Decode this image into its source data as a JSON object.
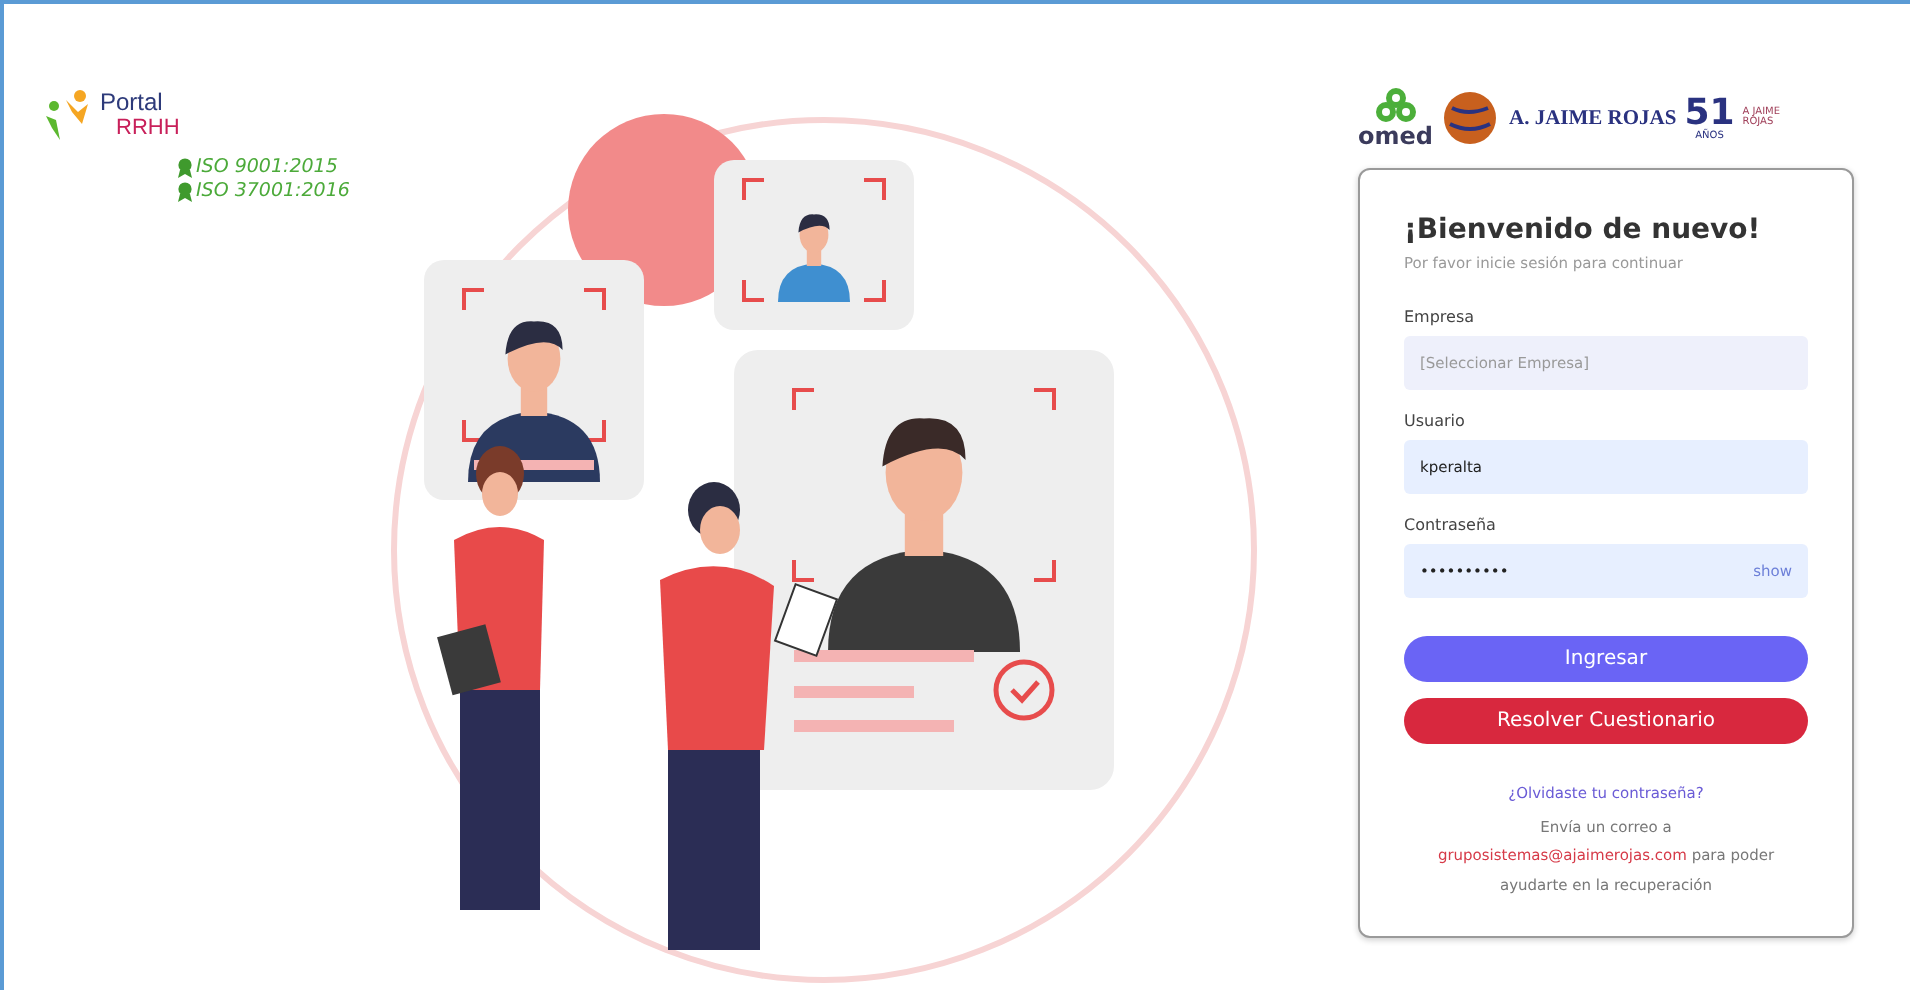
{
  "brand": {
    "name": "Portal",
    "product": "RRHH",
    "certifications": [
      "ISO 9001:2015",
      "ISO 37001:2016"
    ]
  },
  "partner_logos": {
    "omed": "omed",
    "company": "A. JAIME ROJAS",
    "anniversary": "51",
    "anniversary_unit": "AÑOS",
    "anniversary_brand": "A JAIME ROJAS"
  },
  "login": {
    "title": "¡Bienvenido de nuevo!",
    "subtitle": "Por favor inicie sesión para continuar",
    "fields": [
      {
        "kind": "select",
        "label": "Empresa",
        "placeholder": "[Seleccionar Empresa]"
      },
      {
        "kind": "text",
        "label": "Usuario",
        "value": "kperalta"
      },
      {
        "kind": "password",
        "label": "Contraseña",
        "value": "••••••••••",
        "toggle": "show"
      }
    ],
    "buttons": [
      {
        "kind": "primary",
        "label": "Ingresar"
      },
      {
        "kind": "danger",
        "label": "Resolver Cuestionario"
      }
    ],
    "forgot_link": "¿Olvidaste tu contraseña?",
    "help_before": "Envía un correo a",
    "help_email": "gruposistemas@ajaimerojas.com",
    "help_after": "para poder ayudarte en la recuperación"
  }
}
